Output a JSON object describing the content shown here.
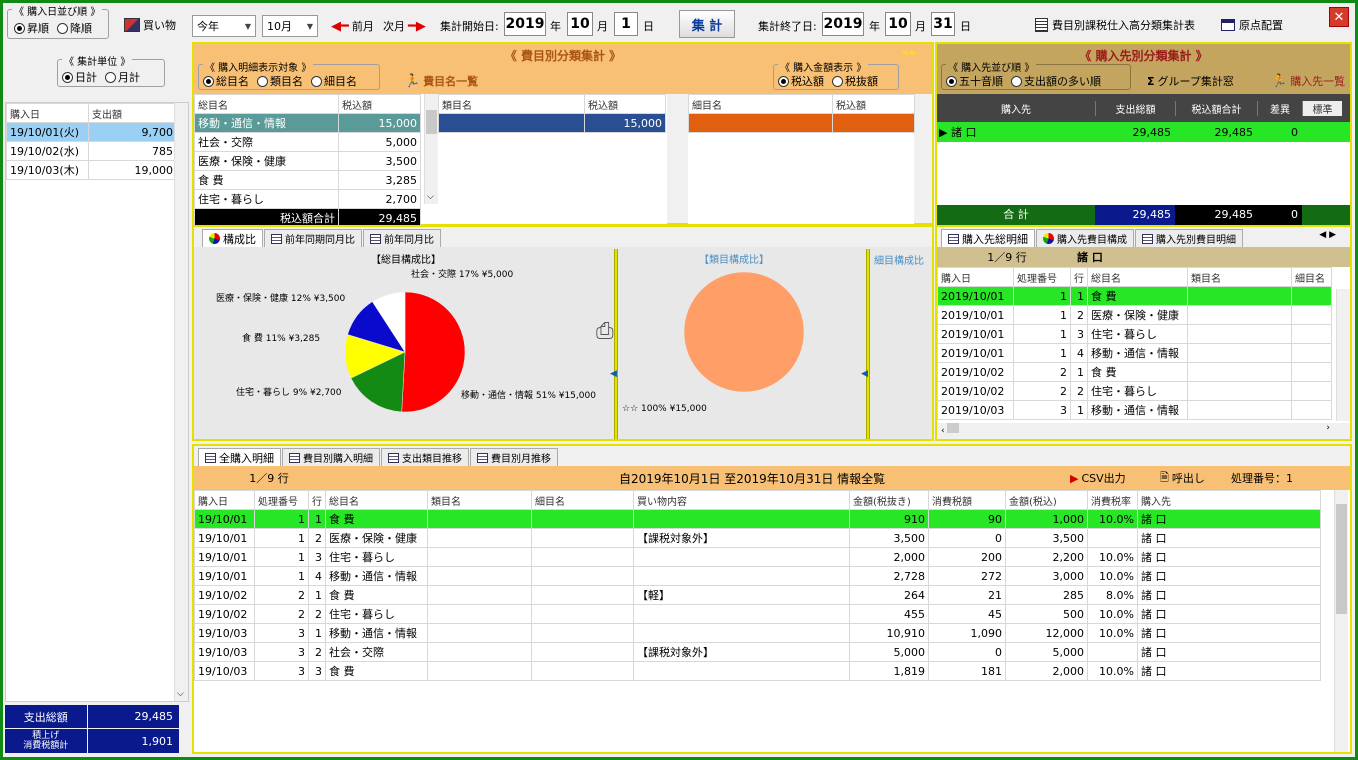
{
  "sort": {
    "title": "《 購入日並び順 》",
    "asc": "昇順",
    "desc": "降順"
  },
  "shopping": "買い物",
  "year_sel": "今年",
  "month_sel": "10月",
  "prev_month": "前月",
  "next_month": "次月",
  "start": {
    "label": "集計開始日:",
    "year": "2019",
    "y": "年",
    "month": "10",
    "m": "月",
    "day": "1",
    "d": "日"
  },
  "run": "集 計",
  "end": {
    "label": "集計終了日:",
    "year": "2019",
    "y": "年",
    "month": "10",
    "m": "月",
    "day": "31",
    "d": "日"
  },
  "report_btn": "費目別課税仕入高分類集計表",
  "layout_btn": "原点配置",
  "unit": {
    "title": "《 集計単位 》",
    "daily": "日計",
    "monthly": "月計"
  },
  "left_table": {
    "headers": [
      "購入日",
      "支出額"
    ],
    "rows": [
      [
        "19/10/01(火)",
        "9,700"
      ],
      [
        "19/10/02(水)",
        "785"
      ],
      [
        "19/10/03(木)",
        "19,000"
      ]
    ]
  },
  "left_total": {
    "label1": "支出総額",
    "val1": "29,485",
    "label2a": "積上げ",
    "label2b": "消費税額計",
    "val2": "1,901"
  },
  "cat": {
    "title": "《 費目別分類集計 》",
    "detail_title": "《 購入明細表示対象 》",
    "opt1": "総目名",
    "opt2": "類目名",
    "opt3": "細目名",
    "list_btn": "費目名一覧",
    "amt_title": "《 購入金額表示 》",
    "taxin": "税込額",
    "taxex": "税抜額"
  },
  "cat_main": {
    "headers": [
      "総目名",
      "税込額"
    ],
    "rows": [
      [
        "移動・通信・情報",
        "15,000"
      ],
      [
        "社会・交際",
        "5,000"
      ],
      [
        "医療・保険・健康",
        "3,500"
      ],
      [
        "食 費",
        "3,285"
      ],
      [
        "住宅・暮らし",
        "2,700"
      ]
    ],
    "total_label": "税込額合計",
    "total": "29,485"
  },
  "cat_sub": {
    "headers": [
      "類目名",
      "税込額"
    ],
    "val": "15,000"
  },
  "cat_sub2": {
    "headers": [
      "細目名",
      "税込額"
    ]
  },
  "vendor": {
    "title": "《 購入先別分類集計 》",
    "sort_title": "《 購入先並び順 》",
    "opt1": "五十音順",
    "opt2": "支出額の多い順",
    "group_btn": "グループ集計窓",
    "list_btn": "購入先一覧",
    "headers": [
      "購入先",
      "支出総額",
      "税込額合計",
      "差異",
      "標準"
    ],
    "row": [
      "諸 口",
      "29,485",
      "29,485",
      "0"
    ],
    "total_label": "合 計",
    "total": [
      "29,485",
      "29,485",
      "0"
    ]
  },
  "chart_tabs": [
    "構成比",
    "前年同期同月比",
    "前年同月比"
  ],
  "pie1": {
    "title": "【総目構成比】"
  },
  "pie2": {
    "title": "【類目構成比】"
  },
  "pie3": {
    "title": "細目構成比"
  },
  "chart_data": [
    {
      "type": "pie",
      "title": "【総目構成比】",
      "categories": [
        "移動・通信・情報",
        "社会・交際",
        "医療・保険・健康",
        "食 費",
        "住宅・暮らし"
      ],
      "values": [
        15000,
        5000,
        3500,
        3285,
        2700
      ],
      "labels": [
        "移動・通信・情報 51% ¥15,000",
        "社会・交際 17% ¥5,000",
        "医療・保険・健康 12% ¥3,500",
        "食 費 11% ¥3,285",
        "住宅・暮らし 9% ¥2,700"
      ],
      "colors": [
        "#ff0000",
        "#138a13",
        "#ffff00",
        "#0a0acc",
        "#ffffff"
      ]
    },
    {
      "type": "pie",
      "title": "【類目構成比】",
      "categories": [
        "☆☆"
      ],
      "values": [
        15000
      ],
      "labels": [
        "☆☆ 100% ¥15,000"
      ],
      "colors": [
        "#ff9e66"
      ]
    }
  ],
  "vdetail": {
    "tabs": [
      "購入先総明細",
      "購入先費目構成",
      "購入先別費目明細"
    ],
    "count": "1／9 行",
    "vendor": "諸 口",
    "headers": [
      "購入日",
      "処理番号",
      "行",
      "総目名",
      "類目名",
      "細目名"
    ],
    "rows": [
      [
        "2019/10/01",
        "1",
        "1",
        "食 費"
      ],
      [
        "2019/10/01",
        "1",
        "2",
        "医療・保険・健康"
      ],
      [
        "2019/10/01",
        "1",
        "3",
        "住宅・暮らし"
      ],
      [
        "2019/10/01",
        "1",
        "4",
        "移動・通信・情報"
      ],
      [
        "2019/10/02",
        "2",
        "1",
        "食 費"
      ],
      [
        "2019/10/02",
        "2",
        "2",
        "住宅・暮らし"
      ],
      [
        "2019/10/03",
        "3",
        "1",
        "移動・通信・情報"
      ]
    ]
  },
  "bottom": {
    "tabs": [
      "全購入明細",
      "費目別購入明細",
      "支出類目推移",
      "費目別月推移"
    ],
    "count": "1／9 行",
    "title": "自2019年10月1日 至2019年10月31日 情報全覧",
    "csv": "CSV出力",
    "recall": "呼出し",
    "proc": "処理番号：1",
    "headers": [
      "購入日",
      "処理番号",
      "行",
      "総目名",
      "類目名",
      "細目名",
      "買い物内容",
      "金額(税抜き)",
      "消費税額",
      "金額(税込)",
      "消費税率",
      "購入先"
    ],
    "rows": [
      [
        "19/10/01",
        "1",
        "1",
        "食 費",
        "",
        "",
        "",
        "910",
        "90",
        "1,000",
        "10.0%",
        "諸 口"
      ],
      [
        "19/10/01",
        "1",
        "2",
        "医療・保険・健康",
        "",
        "",
        "【課税対象外】",
        "3,500",
        "0",
        "3,500",
        "",
        "諸 口"
      ],
      [
        "19/10/01",
        "1",
        "3",
        "住宅・暮らし",
        "",
        "",
        "",
        "2,000",
        "200",
        "2,200",
        "10.0%",
        "諸 口"
      ],
      [
        "19/10/01",
        "1",
        "4",
        "移動・通信・情報",
        "",
        "",
        "",
        "2,728",
        "272",
        "3,000",
        "10.0%",
        "諸 口"
      ],
      [
        "19/10/02",
        "2",
        "1",
        "食 費",
        "",
        "",
        "【軽】",
        "264",
        "21",
        "285",
        "8.0%",
        "諸 口"
      ],
      [
        "19/10/02",
        "2",
        "2",
        "住宅・暮らし",
        "",
        "",
        "",
        "455",
        "45",
        "500",
        "10.0%",
        "諸 口"
      ],
      [
        "19/10/03",
        "3",
        "1",
        "移動・通信・情報",
        "",
        "",
        "",
        "10,910",
        "1,090",
        "12,000",
        "10.0%",
        "諸 口"
      ],
      [
        "19/10/03",
        "3",
        "2",
        "社会・交際",
        "",
        "",
        "【課税対象外】",
        "5,000",
        "0",
        "5,000",
        "",
        "諸 口"
      ],
      [
        "19/10/03",
        "3",
        "3",
        "食 費",
        "",
        "",
        "",
        "1,819",
        "181",
        "2,000",
        "10.0%",
        "諸 口"
      ]
    ]
  }
}
